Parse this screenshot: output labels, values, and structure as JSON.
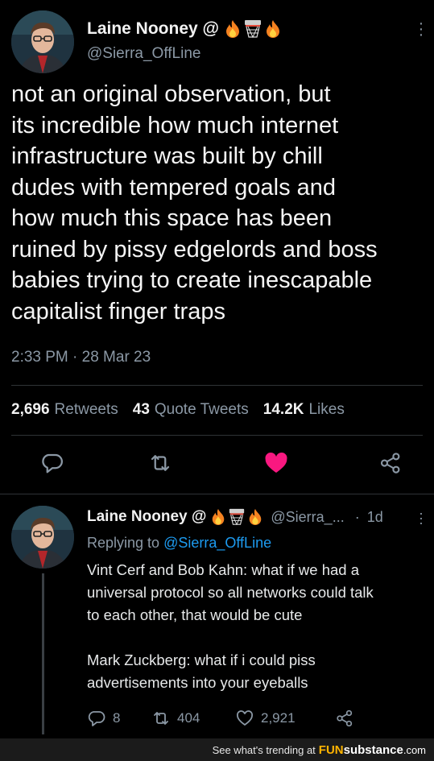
{
  "main_tweet": {
    "author_name": "Laine Nooney @",
    "handle": "@Sierra_OffLine",
    "text": "not an original observation, but\nits incredible how much internet\ninfrastructure was built by chill\ndudes with tempered goals and\nhow much this space has been\nruined by pissy edgelords and boss\nbabies trying to create inescapable\ncapitalist finger traps",
    "timestamp": "2:33 PM · 28 Mar 23",
    "stats": {
      "retweets_count": "2,696",
      "retweets_label": "Retweets",
      "quotes_count": "43",
      "quotes_label": "Quote Tweets",
      "likes_count": "14.2K",
      "likes_label": "Likes"
    },
    "liked": true,
    "like_color": "#f91880"
  },
  "reply_tweet": {
    "author_name": "Laine Nooney @",
    "handle": "@Sierra_...",
    "time": "1d",
    "replying_prefix": "Replying to",
    "replying_handle": "@Sierra_OffLine",
    "text": "Vint Cerf and Bob Kahn: what if we had a\nuniversal protocol so all networks could talk\nto each other, that would be cute\n\nMark Zuckberg: what if i could piss\nadvertisements into your eyeballs",
    "reply_count": "8",
    "retweet_count": "404",
    "like_count": "2,921"
  },
  "icons": [
    "fire-emoji",
    "basketball-hoop-emoji",
    "more-icon",
    "reply-icon",
    "retweet-icon",
    "heart-icon",
    "share-icon"
  ],
  "footer": {
    "text": "See what's trending at",
    "brand_a": "FUN",
    "brand_b": "substance",
    "brand_suffix": ".com"
  },
  "colors": {
    "background": "#000000",
    "secondary_text": "#8b98a5",
    "link": "#1d9bf0",
    "like": "#f91880"
  }
}
